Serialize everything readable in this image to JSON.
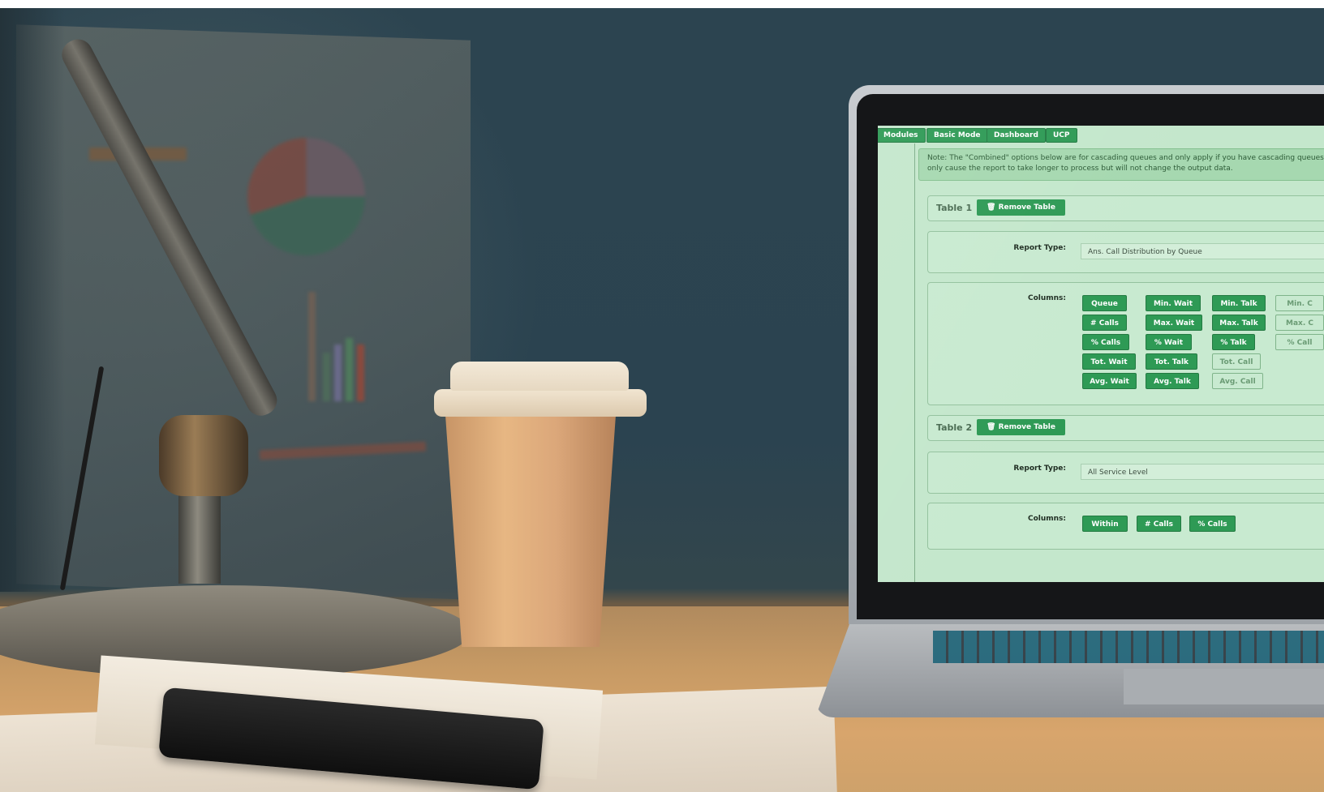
{
  "nav": {
    "items": [
      {
        "label": "Modules"
      },
      {
        "label": "Basic Mode"
      },
      {
        "label": "Dashboard"
      },
      {
        "label": "UCP"
      }
    ]
  },
  "note": {
    "line1": "Note: The \"Combined\" options below are for cascading queues and only apply if you have cascading queues con",
    "line2": "only cause the report to take longer to process but will not change the output data."
  },
  "tables": [
    {
      "title": "Table 1",
      "remove_label": "Remove Table",
      "report_type_label": "Report Type:",
      "report_type_value": "Ans. Call Distribution by Queue",
      "columns_label": "Columns:",
      "columns": [
        {
          "label": "Queue",
          "selected": true
        },
        {
          "label": "# Calls",
          "selected": true
        },
        {
          "label": "% Calls",
          "selected": true
        },
        {
          "label": "Tot. Wait",
          "selected": true
        },
        {
          "label": "Avg. Wait",
          "selected": true
        },
        {
          "label": "Min. Wait",
          "selected": true
        },
        {
          "label": "Max. Wait",
          "selected": true
        },
        {
          "label": "% Wait",
          "selected": true
        },
        {
          "label": "Tot. Talk",
          "selected": true
        },
        {
          "label": "Avg. Talk",
          "selected": true
        },
        {
          "label": "Min. Talk",
          "selected": true
        },
        {
          "label": "Max. Talk",
          "selected": true
        },
        {
          "label": "% Talk",
          "selected": true
        },
        {
          "label": "Tot. Call",
          "selected": false
        },
        {
          "label": "Avg. Call",
          "selected": false
        },
        {
          "label": "Min. C",
          "selected": false
        },
        {
          "label": "Max. C",
          "selected": false
        },
        {
          "label": "% Call",
          "selected": false
        }
      ]
    },
    {
      "title": "Table 2",
      "remove_label": "Remove Table",
      "report_type_label": "Report Type:",
      "report_type_value": "All Service Level",
      "columns_label": "Columns:",
      "columns": [
        {
          "label": "Within",
          "selected": true
        },
        {
          "label": "# Calls",
          "selected": true
        },
        {
          "label": "% Calls",
          "selected": true
        }
      ]
    }
  ],
  "colors": {
    "accent": "#2e9a55",
    "screen_bg": "#c4e7cc"
  },
  "icons": {
    "logo": "swirl-logo-icon",
    "trash": "trash-icon"
  }
}
